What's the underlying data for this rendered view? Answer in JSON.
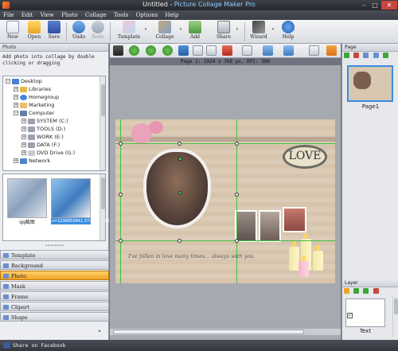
{
  "window": {
    "doc_name": "Untitled",
    "separator": " - ",
    "app_name": "Picture Collage Maker Pro",
    "minimize": "–",
    "maximize": "□",
    "close": "✕"
  },
  "menu": [
    "File",
    "Edit",
    "View",
    "Photo",
    "Collage",
    "Tools",
    "Options",
    "Help"
  ],
  "toolbar": {
    "new": "New",
    "open": "Open",
    "save": "Save",
    "undo": "Undo",
    "redo": "Redo",
    "template": "Template",
    "collage": "Collage",
    "add": "Add",
    "share": "Share",
    "wizard": "Wizard",
    "help": "Help",
    "dropdown_arrow": "▾"
  },
  "left_panel": {
    "header": "Photo",
    "hint": "Add photo into collage by double clicking or dragging",
    "tree": [
      {
        "label": "Desktop",
        "expander": "−"
      },
      {
        "label": "Libraries",
        "expander": "+"
      },
      {
        "label": "Homegroup",
        "expander": "+"
      },
      {
        "label": "Marketing",
        "expander": "+"
      },
      {
        "label": "Computer",
        "expander": "−"
      },
      {
        "label": "SYSTEM (C:)",
        "expander": "+"
      },
      {
        "label": "TOOLS (D:)",
        "expander": "+"
      },
      {
        "label": "WORK (E:)",
        "expander": "+"
      },
      {
        "label": "DATA (F:)",
        "expander": "+"
      },
      {
        "label": "DVD Drive (G:)",
        "expander": "+"
      },
      {
        "label": "Network",
        "expander": "+"
      }
    ],
    "thumbnails": [
      {
        "caption": "qq截图"
      },
      {
        "caption": "u=1298850841,3722167292&fm=21&gp=0.jpg"
      }
    ],
    "grip": "••••••••",
    "tabs": [
      "Template",
      "Background",
      "Photo",
      "Mask",
      "Frame",
      "Clipart",
      "Shape"
    ],
    "active_tab": "Photo",
    "more": "»"
  },
  "canvas_info": {
    "page_info": "Page 1: 1024 x 768 px, DPI: 300",
    "love_text": "LOVE",
    "caption": "I've fallen in love many times... always with you."
  },
  "right_panel": {
    "page_header": "Page",
    "page_label": "Page1",
    "layer_header": "Layer",
    "layer_label": "Text",
    "layer_check": "✓"
  },
  "status": {
    "text": "Share on Facebook"
  },
  "colors": {
    "accent": "#f0a425",
    "selection": "#3b8de0",
    "guide": "#3fc23f",
    "facebook": "#3b5998"
  }
}
